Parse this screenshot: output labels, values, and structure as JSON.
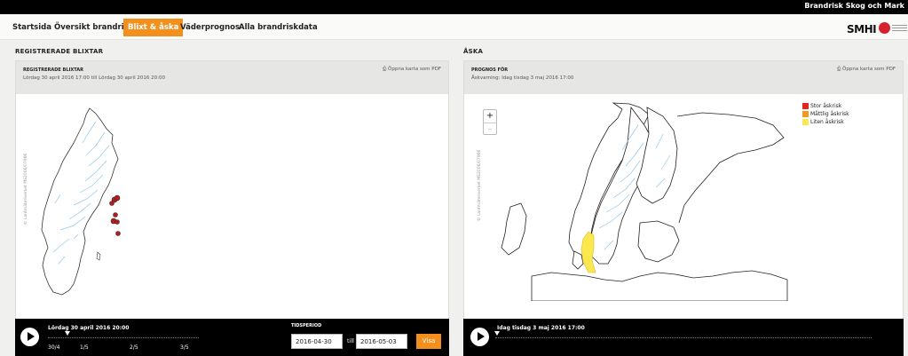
{
  "header": {
    "brand": "Brandrisk Skog och Mark"
  },
  "nav": {
    "items": [
      {
        "label": "Startsida"
      },
      {
        "label": "Översikt brandrisk"
      },
      {
        "label": "Blixt & åska"
      },
      {
        "label": "Väderprognos"
      },
      {
        "label": "Alla brandriskdata"
      }
    ],
    "active_index": 2
  },
  "logos": {
    "smhi": "SMHI",
    "msb": "msb-logo"
  },
  "left": {
    "section_title": "REGISTRERADE BLIXTAR",
    "box_title": "REGISTRERADE BLIXTAR",
    "box_subtitle": "Lördag 30 april 2016 17:00 till Lördag 30 april 2016 20:00",
    "pdf_link": "Öppna karta som PDF",
    "copyright": "© Lantmäteriverket MS2006/07966",
    "player": {
      "time_label": "Lördag 30 april 2016 20:00",
      "ticks": [
        "30/4",
        "1/5",
        "2/5",
        "3/5"
      ],
      "tidsperiod_label": "TIDSPERIOD",
      "from_date": "2016-04-30",
      "till_label": "till",
      "to_date": "2016-05-03",
      "show_button": "Visa"
    }
  },
  "right": {
    "section_title": "ÅSKA",
    "box_title": "PROGNOS FÖR",
    "box_subtitle": "Åskvarning: Idag tisdag 3 maj 2016 17:00",
    "pdf_link": "Öppna karta som PDF",
    "copyright": "© Lantmäteriverket MS2006/07966",
    "zoom_in": "+",
    "zoom_out": "–",
    "legend": [
      {
        "label": "Stor åskrisk",
        "color": "#e8221c"
      },
      {
        "label": "Måttlig åskrisk",
        "color": "#f39a1e"
      },
      {
        "label": "Liten åskrisk",
        "color": "#fbe84e"
      }
    ],
    "player": {
      "time_label": "Idag tisdag 3 maj 2016 17:00"
    }
  },
  "colors": {
    "accent": "#f3901d",
    "topbar": "#000000",
    "rivers": "#8fc7e8"
  }
}
